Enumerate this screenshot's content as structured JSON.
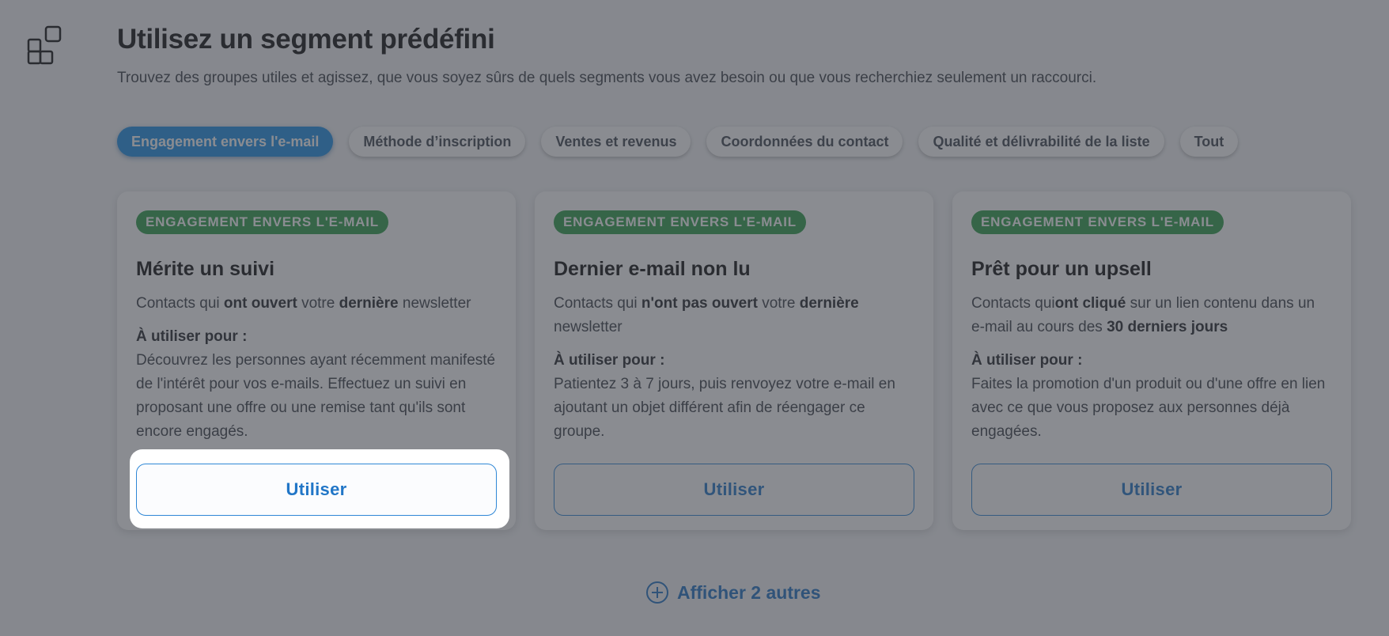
{
  "header": {
    "title": "Utilisez un segment prédéfini",
    "subtitle": "Trouvez des groupes utiles et agissez, que vous soyez sûrs de quels segments vous avez besoin ou que vous recherchiez seulement un raccourci.",
    "icon": "segments-grid-icon"
  },
  "tabs": [
    {
      "label": "Engagement envers l'e-mail",
      "active": true
    },
    {
      "label": "Méthode d’inscription"
    },
    {
      "label": "Ventes et revenus"
    },
    {
      "label": "Coordonnées du contact"
    },
    {
      "label": "Qualité et délivrabilité de la liste"
    },
    {
      "label": "Tout"
    }
  ],
  "cards": [
    {
      "badge": "ENGAGEMENT ENVERS L'E-MAIL",
      "title": "Mérite un suivi",
      "desc": {
        "p1": "Contacts qui ",
        "b1": "ont ouvert",
        "p2": " votre ",
        "b2": "dernière",
        "p3": " newsletter"
      },
      "use_label": "À utiliser pour :",
      "use_text": "Découvrez les personnes ayant récemment manifesté de l'intérêt pour vos e-mails. Effectuez un suivi en proposant une offre ou une remise tant qu'ils sont encore engagés.",
      "button": "Utiliser"
    },
    {
      "badge": "ENGAGEMENT ENVERS L'E-MAIL",
      "title": "Dernier e-mail non lu",
      "desc": {
        "p1": "Contacts qui ",
        "b1": "n'ont pas ouvert",
        "p2": " votre ",
        "b2": "dernière",
        "p3": " newsletter"
      },
      "use_label": "À utiliser pour :",
      "use_text": "Patientez 3 à 7 jours, puis renvoyez votre e-mail en ajoutant un objet différent afin de réengager ce groupe.",
      "button": "Utiliser"
    },
    {
      "badge": "ENGAGEMENT ENVERS L'E-MAIL",
      "title": "Prêt pour un upsell",
      "desc": {
        "p1": "Contacts qui",
        "b1": "ont cliqué",
        "p2": " sur un lien contenu dans un e-mail au cours des ",
        "b2": "30 derniers jours",
        "p3": ""
      },
      "use_label": "À utiliser pour :",
      "use_text": "Faites la promotion d'un produit ou d'une offre en lien avec ce que vous proposez aux personnes déjà engagées.",
      "button": "Utiliser"
    }
  ],
  "show_more": {
    "label": "Afficher 2 autres",
    "icon": "plus-circle-icon"
  },
  "colors": {
    "accent": "#1d8ee6",
    "badge_green": "#2f9e4a",
    "link_blue": "#1f72c4",
    "overlay": "rgba(60,64,72,0.6)"
  }
}
